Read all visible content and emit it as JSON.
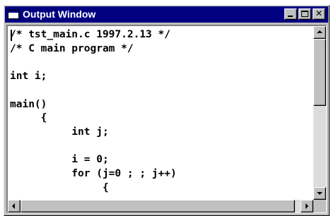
{
  "window": {
    "title": "Output Window",
    "title_icon": "window-icon",
    "controls": [
      "minimize",
      "maximize",
      "close"
    ]
  },
  "content": {
    "lines": [
      "/* tst_main.c 1997.2.13 */",
      "/* C main program */",
      "",
      "int i;",
      "",
      "main()",
      "     {",
      "          int j;",
      "",
      "          i = 0;",
      "          for (j=0 ; ; j++)",
      "               {"
    ]
  },
  "scrollbars": {
    "vertical": {
      "position": 0.0,
      "visible_fraction": 0.45
    },
    "horizontal": {
      "position": 0.0,
      "visible_fraction": 0.98
    }
  },
  "colors": {
    "titlebar": "#000080",
    "face": "#c0c0c0",
    "text_bg": "#ffffff"
  }
}
